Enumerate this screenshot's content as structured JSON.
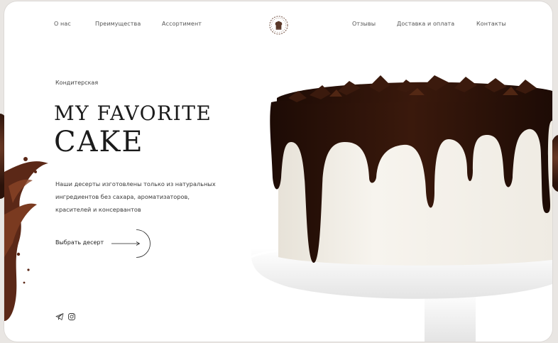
{
  "nav": {
    "left": [
      "О нас",
      "Преимущества",
      "Ассортимент"
    ],
    "right": [
      "Отзывы",
      "Доставка и оплата",
      "Контакты"
    ]
  },
  "logo_icon": "chef-hat-wreath-icon",
  "hero": {
    "kicker": "Кондитерская",
    "title_line1": "MY FAVORITE",
    "title_line2": "CAKE",
    "description": "Наши десерты изготовлены только из натуральных ингредиентов без сахара, ароматизаторов, красителей и консервантов",
    "cta_label": "Выбрать десерт",
    "cta_icon": "arrow-right-icon"
  },
  "social": [
    "telegram-icon",
    "instagram-icon"
  ],
  "colors": {
    "background": "#ffffff",
    "text": "#1b1b1b",
    "chocolate": "#2b1208",
    "cream": "#f3f0ea"
  }
}
